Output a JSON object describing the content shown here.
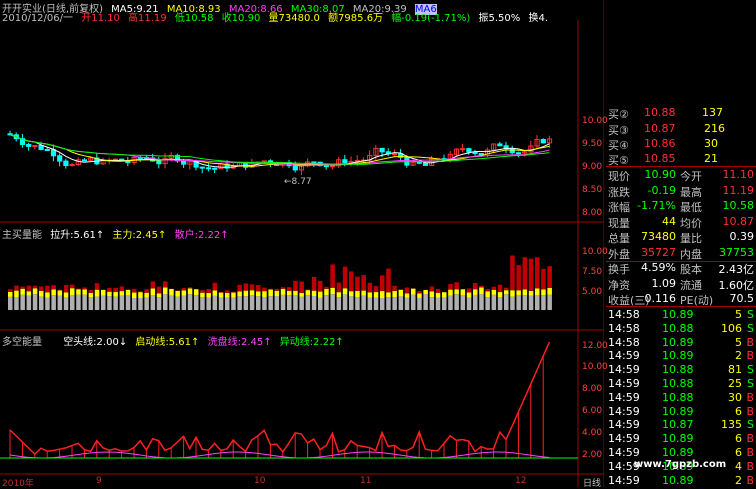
{
  "header": {
    "line1_title": "开开实业(日线,前复权)",
    "ma5": "MA5:9.21",
    "ma10": "MA10:8.93",
    "ma20": "MA20:8.66",
    "ma30": "MA30:8.07",
    "ma_extra": "MA20:9.39",
    "ma_extra2": "MA6",
    "line2_date": "2010/12/06/一",
    "line2_open": "开11.10",
    "line2_high": "高11.19",
    "line2_low": "低10.58",
    "line2_close": "收10.90",
    "line2_vol": "量73480.0",
    "line2_amt": "额7985.6万",
    "line2_chg": "幅-0.19(-1.71%)",
    "line2_zf": "振5.50%",
    "line2_hs": "换4."
  },
  "price_axis": [
    "10.00",
    "9.50",
    "9.00",
    "8.50",
    "8.00"
  ],
  "low_marker": "←8.77",
  "panel2": {
    "title": "主买量能",
    "v1": "拉升:5.61↑",
    "v2": "主力:2.45↑",
    "v3": "散户:2.22↑",
    "axis": [
      "10.00",
      "7.50",
      "5.00"
    ]
  },
  "panel3": {
    "title": "多空能量",
    "v1": "空头线:2.00↓",
    "v2": "启动线:5.61↑",
    "v3": "洗盘线:2.45↑",
    "v4": "异动线:2.22↑",
    "axis": [
      "12.00",
      "10.00",
      "8.00",
      "6.00",
      "4.00",
      "2.00"
    ]
  },
  "x_axis": [
    "2010年",
    "9",
    "10",
    "11",
    "12"
  ],
  "x_label": "日线",
  "watermark": "www.7gpzb.com",
  "book": [
    {
      "label": "买③",
      "price": "10.87",
      "vol": "216"
    },
    {
      "label": "买④",
      "price": "10.86",
      "vol": "30"
    },
    {
      "label": "买⑤",
      "price": "10.85",
      "vol": "21"
    }
  ],
  "book_top": {
    "label": "买②",
    "price": "10.88",
    "vol": "137"
  },
  "quote": [
    {
      "l1": "现价",
      "v1": "10.90",
      "l2": "今开",
      "v2": "11.10"
    },
    {
      "l1": "涨跌",
      "v1": "-0.19",
      "l2": "最高",
      "v2": "11.19"
    },
    {
      "l1": "涨幅",
      "v1": "-1.71%",
      "l2": "最低",
      "v2": "10.58"
    },
    {
      "l1": "现量",
      "v1": "44",
      "l2": "均价",
      "v2": "10.87"
    },
    {
      "l1": "总量",
      "v1": "73480",
      "l2": "量比",
      "v2": "0.39"
    },
    {
      "l1": "外盘",
      "v1": "35727",
      "l2": "内盘",
      "v2": "37753"
    },
    {
      "l1": "换手",
      "v1": "4.59%",
      "l2": "股本",
      "v2": "2.43亿"
    },
    {
      "l1": "净资",
      "v1": "1.09",
      "l2": "流通",
      "v2": "1.60亿"
    },
    {
      "l1": "收益(三)",
      "v1": "0.116",
      "l2": "PE(动)",
      "v2": "70.5"
    }
  ],
  "ticks": [
    {
      "t": "14:58",
      "p": "10.89",
      "v": "5",
      "d": "S"
    },
    {
      "t": "14:58",
      "p": "10.88",
      "v": "106",
      "d": "S"
    },
    {
      "t": "14:58",
      "p": "10.89",
      "v": "5",
      "d": "B"
    },
    {
      "t": "14:59",
      "p": "10.89",
      "v": "2",
      "d": "B"
    },
    {
      "t": "14:59",
      "p": "10.88",
      "v": "81",
      "d": "S"
    },
    {
      "t": "14:59",
      "p": "10.88",
      "v": "25",
      "d": "S"
    },
    {
      "t": "14:59",
      "p": "10.88",
      "v": "30",
      "d": "B"
    },
    {
      "t": "14:59",
      "p": "10.89",
      "v": "6",
      "d": "B"
    },
    {
      "t": "14:59",
      "p": "10.87",
      "v": "135",
      "d": "S"
    },
    {
      "t": "14:59",
      "p": "10.89",
      "v": "6",
      "d": "B"
    },
    {
      "t": "14:59",
      "p": "10.89",
      "v": "6",
      "d": "B"
    },
    {
      "t": "14:59",
      "p": "10.89",
      "v": "4",
      "d": "B"
    },
    {
      "t": "14:59",
      "p": "10.89",
      "v": "2",
      "d": "B"
    }
  ],
  "colors": {
    "up": "#ff3030",
    "down": "#00ffff",
    "green": "#00ff00",
    "yellow": "#ffff00",
    "magenta": "#ff40ff"
  }
}
